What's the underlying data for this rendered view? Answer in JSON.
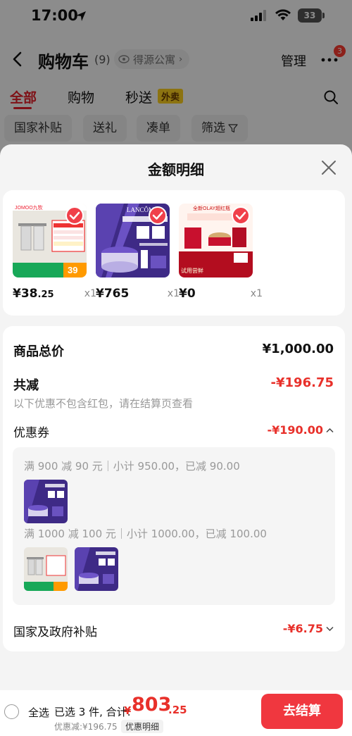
{
  "status_bar": {
    "time": "17:00",
    "battery": "33"
  },
  "header": {
    "title": "购物车",
    "count": "(9)",
    "address": "得源公寓",
    "manage": "管理",
    "notif_badge": "3"
  },
  "tabs": [
    {
      "label": "全部",
      "active": true
    },
    {
      "label": "购物",
      "active": false
    },
    {
      "label": "秒送",
      "active": false
    }
  ],
  "tab_tag": "外卖",
  "filters": [
    "国家补贴",
    "送礼",
    "凑单",
    "筛选"
  ],
  "sheet": {
    "title": "金额明细",
    "products": [
      {
        "price_int": "¥38",
        "price_dec": ".25",
        "qty": "x1"
      },
      {
        "price_int": "¥765",
        "price_dec": "",
        "qty": "x1"
      },
      {
        "price_int": "¥0",
        "price_dec": "",
        "qty": "x1"
      }
    ],
    "product_thumb_texts": {
      "towel_brand": "JOMOO九牧",
      "towel_price": "39",
      "lancome_brand": "LANCÔME",
      "olay_brand": "全新OLAY超红瓶",
      "olay_trial": "试用尝鲜"
    },
    "goods_total_label": "商品总价",
    "goods_total_value": "¥1,000.00",
    "reduce_label": "共减",
    "reduce_value": "-¥196.75",
    "reduce_note": "以下优惠不包含红包，请在结算页查看",
    "coupon_label": "优惠券",
    "coupon_value": "-¥190.00",
    "coupon_rules": [
      "满 900 减 90 元｜小计 950.00，已减 90.00",
      "满 1000 减 100 元｜小计 1000.00，已减 100.00"
    ],
    "subsidy_label": "国家及政府补贴",
    "subsidy_value": "-¥6.75"
  },
  "bottom": {
    "select_all": "全选",
    "selected_info": "已选 3 件, 合计:",
    "currency": "¥",
    "total_int": "803",
    "total_dec": ".25",
    "discount_note": "优惠减:¥196.75",
    "detail_chip": "优惠明细",
    "checkout": "去结算"
  },
  "colors": {
    "accent": "#e8302a",
    "checkout": "#f0373f",
    "tag": "#ffd21f"
  }
}
